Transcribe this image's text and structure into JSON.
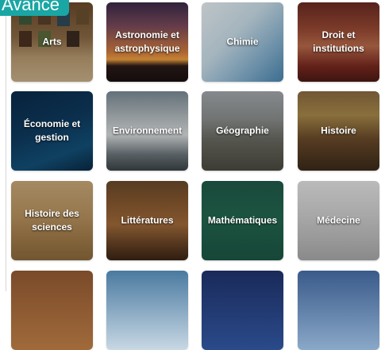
{
  "header": {
    "tag_label": "Avancé"
  },
  "tiles": [
    {
      "label": "Arts"
    },
    {
      "label": "Astronomie et\nastrophysique"
    },
    {
      "label": "Chimie"
    },
    {
      "label": "Droit et\ninstitutions"
    },
    {
      "label": "Économie et\ngestion"
    },
    {
      "label": "Environnement"
    },
    {
      "label": "Géographie"
    },
    {
      "label": "Histoire"
    },
    {
      "label": "Histoire des\nsciences"
    },
    {
      "label": "Littératures"
    },
    {
      "label": "Mathématiques"
    },
    {
      "label": "Médecine"
    }
  ]
}
